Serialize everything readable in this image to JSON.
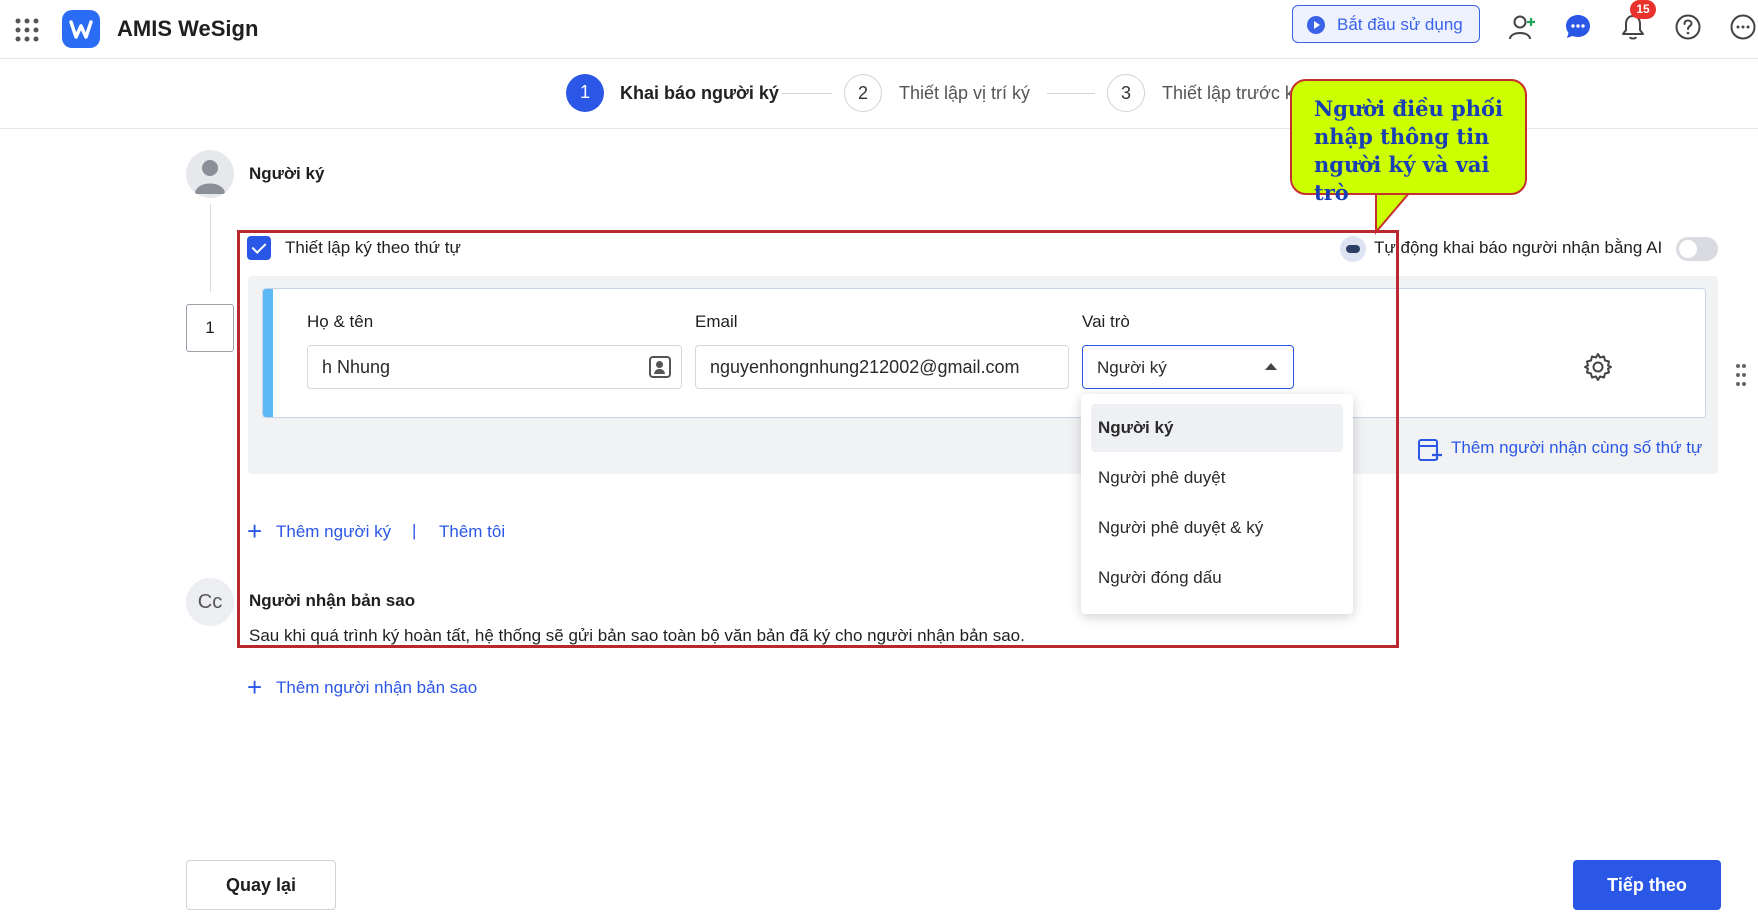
{
  "header": {
    "app_title": "AMIS WeSign",
    "start_button": "Bắt đầu sử dụng",
    "notification_count": "15",
    "icons": [
      "apps-grid-icon",
      "wesign-logo",
      "play-icon",
      "add-user-icon",
      "chat-icon",
      "bell-icon",
      "help-icon",
      "more-icon"
    ]
  },
  "stepper": {
    "steps": [
      {
        "number": "1",
        "label": "Khai báo người ký",
        "active": true
      },
      {
        "number": "2",
        "label": "Thiết lập vị trí ký",
        "active": false
      },
      {
        "number": "3",
        "label": "Thiết lập trước k",
        "active": false
      }
    ]
  },
  "signers": {
    "title": "Người ký",
    "ordered_signing_label": "Thiết lập ký theo thứ tự",
    "ordered_signing_checked": true,
    "ai_auto_label": "Tự động khai báo người nhận bằng AI",
    "ai_auto_enabled": false,
    "order_number": "1",
    "fields": {
      "name_label": "Họ & tên",
      "name_value": "h Nhung",
      "email_label": "Email",
      "email_value": "nguyenhongnhung212002@gmail.com",
      "role_label": "Vai trò",
      "role_value": "Người ký"
    },
    "role_options": [
      "Người ký",
      "Người phê duyệt",
      "Người phê duyệt & ký",
      "Người đóng dấu"
    ],
    "add_same_order_label": "Thêm người nhận cùng số thứ tự",
    "add_signer_label": "Thêm người ký",
    "separator": "|",
    "add_me_label": "Thêm tôi"
  },
  "cc": {
    "avatar_text": "Cc",
    "title": "Người nhận bản sao",
    "description": "Sau khi quá trình ký hoàn tất, hệ thống sẽ gửi bản sao toàn bộ văn bản đã ký cho người nhận bản sao.",
    "add_label": "Thêm người nhận bản sao"
  },
  "annotation": {
    "callout_text": "Người điều phối nhập thông tin người ký và vai trò",
    "frame_color": "#b8282e",
    "callout_bg": "#ccff00"
  },
  "footer": {
    "back_label": "Quay lại",
    "next_label": "Tiếp theo"
  },
  "colors": {
    "primary": "#2b57e6",
    "accent_bar": "#5cb8f5",
    "badge": "#e8322b"
  }
}
